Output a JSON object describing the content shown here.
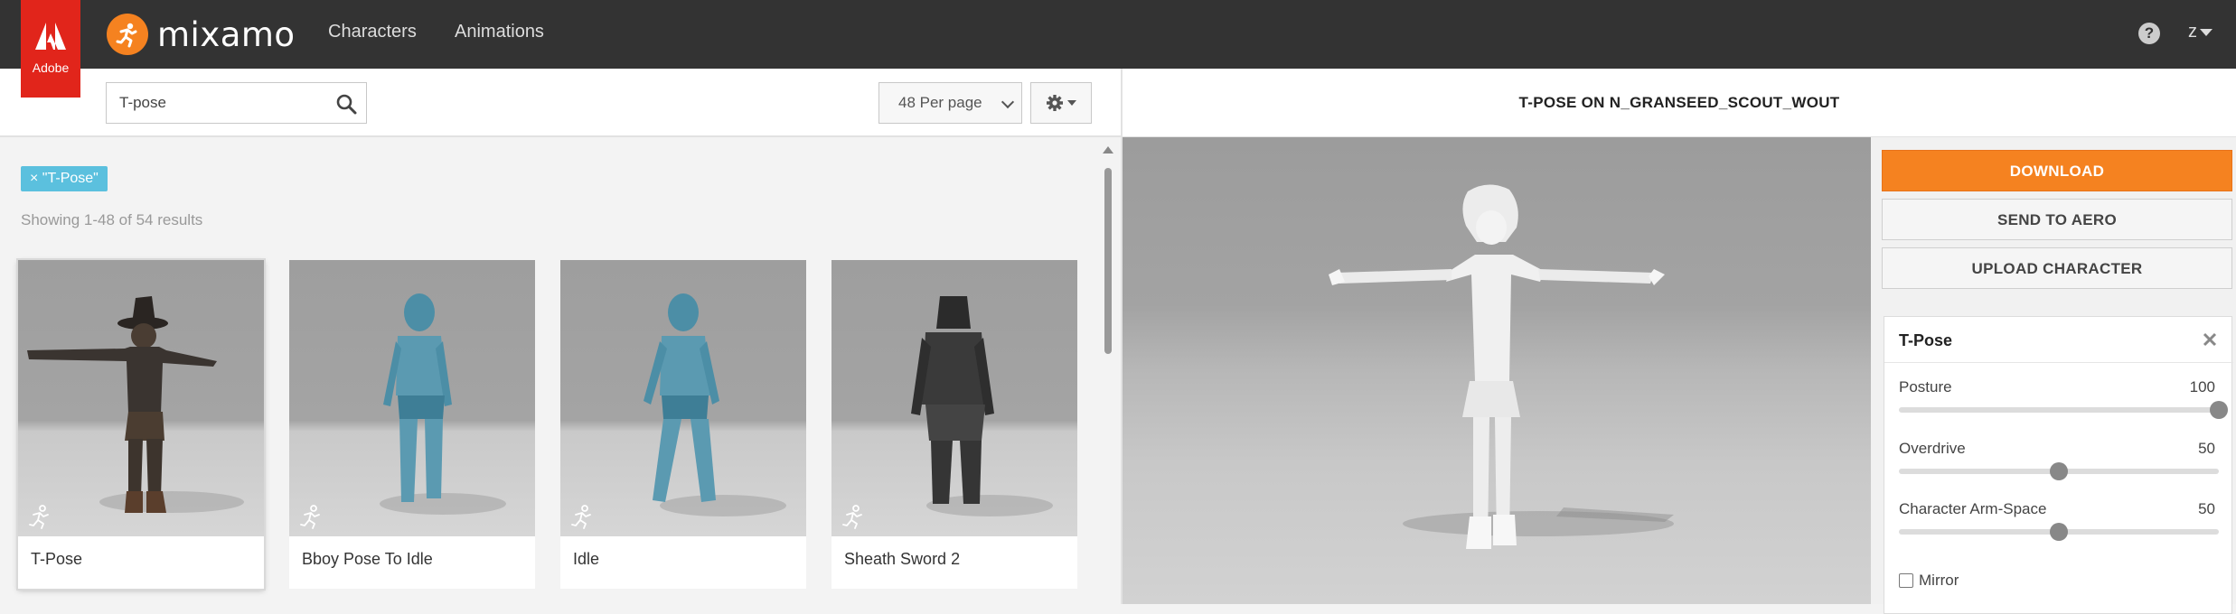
{
  "header": {
    "adobe_logo_text": "Adobe",
    "brand_name": "mixamo",
    "nav": [
      {
        "label": "Characters"
      },
      {
        "label": "Animations"
      }
    ],
    "help_label": "?",
    "user_label": "z"
  },
  "browser": {
    "search": {
      "value": "T-pose",
      "placeholder": ""
    },
    "per_page": "48 Per page",
    "filter_tag": "× \"T-Pose\"",
    "results_text": "Showing 1-48 of 54 results",
    "cards": [
      {
        "label": "T-Pose",
        "selected": true
      },
      {
        "label": "Bboy Pose To Idle",
        "selected": false
      },
      {
        "label": "Idle",
        "selected": false
      },
      {
        "label": "Sheath Sword 2",
        "selected": false
      }
    ]
  },
  "viewer": {
    "title": "T-POSE ON N_GRANSEED_SCOUT_WOUT"
  },
  "panel": {
    "download_label": "DOWNLOAD",
    "send_to_aero_label": "SEND TO AERO",
    "upload_character_label": "UPLOAD CHARACTER",
    "settings": {
      "title": "T-Pose",
      "sliders": [
        {
          "label": "Posture",
          "value": 100,
          "min": 0,
          "max": 100
        },
        {
          "label": "Overdrive",
          "value": 50,
          "min": 0,
          "max": 100
        },
        {
          "label": "Character Arm-Space",
          "value": 50,
          "min": 0,
          "max": 100
        }
      ],
      "mirror_label": "Mirror",
      "mirror_checked": false
    }
  },
  "colors": {
    "accent": "#f58220",
    "topbar": "#333333",
    "adobe_red": "#e1251b",
    "tag": "#5bc0de"
  }
}
